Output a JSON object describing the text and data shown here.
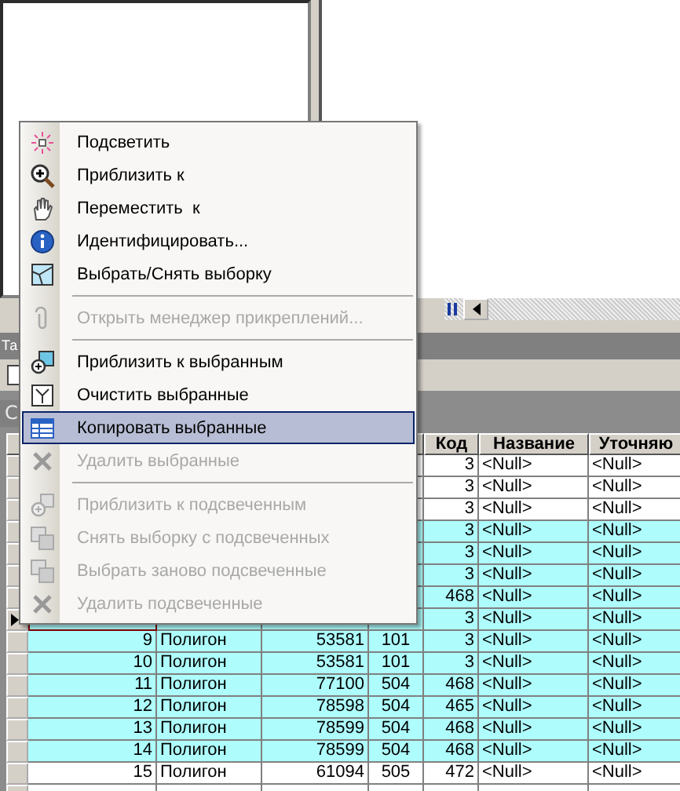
{
  "table_window": {
    "title": "Та",
    "subtitle": "С"
  },
  "table": {
    "columns": [
      {},
      {},
      {},
      {},
      {
        "label": "Код"
      },
      {
        "label": "Название"
      },
      {
        "label": "Уточняю"
      }
    ],
    "rows": [
      {
        "selected": false,
        "current": false,
        "cells": [
          "",
          "",
          "",
          "",
          "3",
          "<Null>",
          "<Null>"
        ]
      },
      {
        "selected": false,
        "current": false,
        "cells": [
          "",
          "",
          "",
          "",
          "3",
          "<Null>",
          "<Null>"
        ]
      },
      {
        "selected": false,
        "current": false,
        "cells": [
          "",
          "",
          "",
          "",
          "3",
          "<Null>",
          "<Null>"
        ]
      },
      {
        "selected": true,
        "current": false,
        "cells": [
          "",
          "",
          "",
          "",
          "3",
          "<Null>",
          "<Null>"
        ]
      },
      {
        "selected": true,
        "current": false,
        "cells": [
          "",
          "",
          "",
          "",
          "3",
          "<Null>",
          "<Null>"
        ]
      },
      {
        "selected": true,
        "current": false,
        "cells": [
          "",
          "",
          "",
          "",
          "3",
          "<Null>",
          "<Null>"
        ]
      },
      {
        "selected": true,
        "current": false,
        "cells": [
          "",
          "",
          "",
          "",
          "468",
          "<Null>",
          "<Null>"
        ]
      },
      {
        "selected": true,
        "current": true,
        "cells": [
          "",
          "",
          "",
          "",
          "3",
          "<Null>",
          "<Null>"
        ]
      },
      {
        "selected": true,
        "current": false,
        "cells": [
          "9",
          "Полигон",
          "53581",
          "101",
          "3",
          "<Null>",
          "<Null>"
        ]
      },
      {
        "selected": true,
        "current": false,
        "cells": [
          "10",
          "Полигон",
          "53581",
          "101",
          "3",
          "<Null>",
          "<Null>"
        ]
      },
      {
        "selected": true,
        "current": false,
        "cells": [
          "11",
          "Полигон",
          "77100",
          "504",
          "468",
          "<Null>",
          "<Null>"
        ]
      },
      {
        "selected": true,
        "current": false,
        "cells": [
          "12",
          "Полигон",
          "78598",
          "504",
          "465",
          "<Null>",
          "<Null>"
        ]
      },
      {
        "selected": true,
        "current": false,
        "cells": [
          "13",
          "Полигон",
          "78599",
          "504",
          "468",
          "<Null>",
          "<Null>"
        ]
      },
      {
        "selected": true,
        "current": false,
        "cells": [
          "14",
          "Полигон",
          "78599",
          "504",
          "468",
          "<Null>",
          "<Null>"
        ]
      },
      {
        "selected": false,
        "current": false,
        "cells": [
          "15",
          "Полигон",
          "61094",
          "505",
          "472",
          "<Null>",
          "<Null>"
        ]
      },
      {
        "cells": []
      }
    ]
  },
  "context_menu": [
    {
      "kind": "item",
      "label": "Подсветить",
      "disabled": false,
      "selected": false
    },
    {
      "kind": "item",
      "label": "Приблизить к",
      "disabled": false,
      "selected": false
    },
    {
      "kind": "item",
      "label": "Переместить  к",
      "disabled": false,
      "selected": false
    },
    {
      "kind": "item",
      "label": "Идентифицировать...",
      "disabled": false,
      "selected": false
    },
    {
      "kind": "item",
      "label": "Выбрать/Снять выборку",
      "disabled": false,
      "selected": false
    },
    {
      "kind": "separator"
    },
    {
      "kind": "item",
      "label": "Открыть менеджер прикреплений...",
      "disabled": true,
      "selected": false
    },
    {
      "kind": "separator"
    },
    {
      "kind": "item",
      "label": "Приблизить к выбранным",
      "disabled": false,
      "selected": false
    },
    {
      "kind": "item",
      "label": "Очистить выбранные",
      "disabled": false,
      "selected": false
    },
    {
      "kind": "item",
      "label": "Копировать выбранные",
      "disabled": false,
      "selected": true
    },
    {
      "kind": "item",
      "label": "Удалить выбранные",
      "disabled": true,
      "selected": false
    },
    {
      "kind": "separator"
    },
    {
      "kind": "item",
      "label": "Приблизить к подсвеченным",
      "disabled": true,
      "selected": false
    },
    {
      "kind": "item",
      "label": "Снять выборку с подсвеченных",
      "disabled": true,
      "selected": false
    },
    {
      "kind": "item",
      "label": "Выбрать заново подсвеченные",
      "disabled": true,
      "selected": false
    },
    {
      "kind": "item",
      "label": "Удалить подсвеченные",
      "disabled": true,
      "selected": false
    }
  ]
}
